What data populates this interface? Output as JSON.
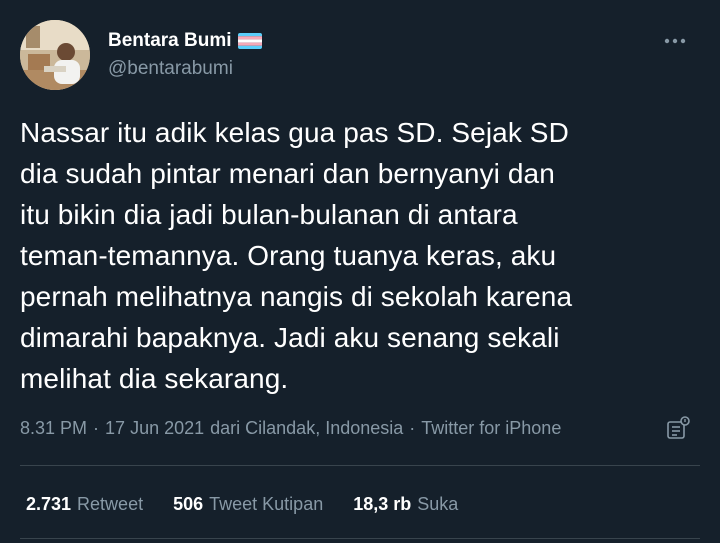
{
  "author": {
    "display_name": "Bentara Bumi",
    "handle": "@bentarabumi",
    "flag_icon": "transgender-flag-icon"
  },
  "tweet": {
    "lines": [
      "Nassar itu adik kelas gua pas SD. Sejak SD",
      "dia sudah pintar menari dan bernyanyi dan",
      "itu bikin dia jadi bulan-bulanan di antara",
      "teman-temannya. Orang tuanya keras, aku",
      "pernah melihatnya nangis di sekolah karena",
      "dimarahi bapaknya. Jadi aku senang sekali",
      "melihat dia sekarang."
    ]
  },
  "meta": {
    "time": "8.31 PM",
    "date": "17 Jun 2021",
    "location": "dari Cilandak, Indonesia",
    "source": "Twitter for iPhone",
    "separator": "·"
  },
  "stats": {
    "retweets": {
      "count": "2.731",
      "label": "Retweet"
    },
    "quotes": {
      "count": "506",
      "label": "Tweet Kutipan"
    },
    "likes": {
      "count": "18,3 rb",
      "label": "Suka"
    }
  },
  "colors": {
    "background": "#15202b",
    "text_primary": "#ffffff",
    "text_secondary": "#8899a6",
    "divider": "#38444d"
  }
}
